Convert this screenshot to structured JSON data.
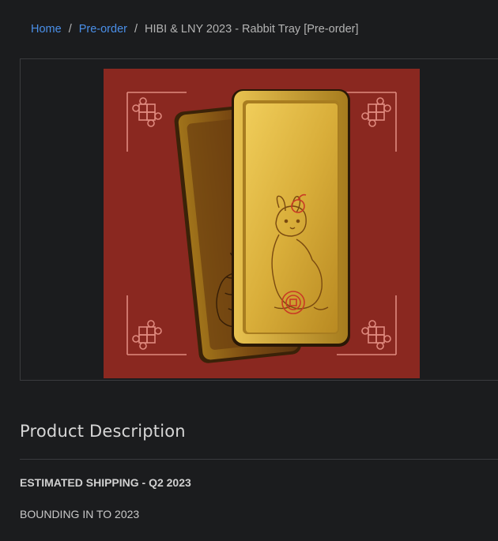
{
  "breadcrumb": {
    "home": "Home",
    "separator": "/",
    "category": "Pre-order",
    "current": "HIBI & LNY 2023 - Rabbit Tray [Pre-order]"
  },
  "product_image": {
    "icon": "rabbit-tray-product-photo",
    "colors": {
      "background": "#8a2820",
      "gold": "#d9ae3a",
      "knot": "#e08a7f"
    }
  },
  "description": {
    "title": "Product Description",
    "shipping": "ESTIMATED SHIPPING - Q2 2023",
    "tagline": "BOUNDING IN TO 2023"
  },
  "theme": {
    "background": "#1b1c1e",
    "link": "#4a8fe8",
    "border": "#3a3b3e"
  }
}
